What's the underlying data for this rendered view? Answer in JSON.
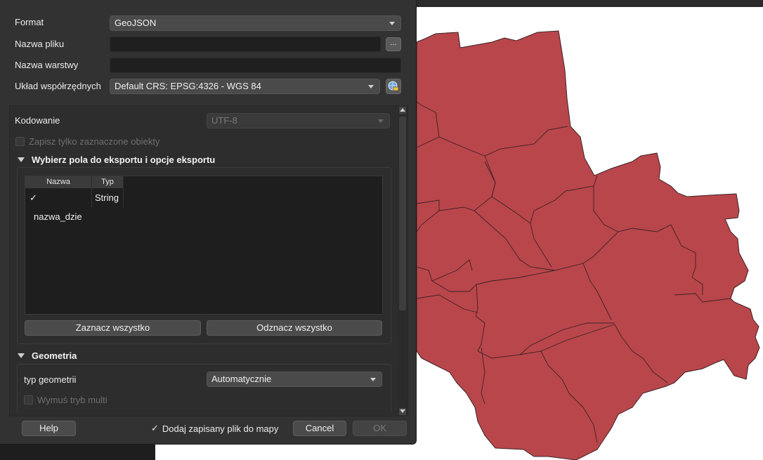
{
  "colors": {
    "district_fill": "#b9464b",
    "district_stroke": "#3b2225",
    "map_bg": "#ffffff"
  },
  "form": {
    "format_label": "Format",
    "format_value": "GeoJSON",
    "filename_label": "Nazwa pliku",
    "filename_value": "",
    "browse_label": "...",
    "layer_label": "Nazwa warstwy",
    "layer_value": "",
    "crs_label": "Układ współrzędnych",
    "crs_value": "Default CRS: EPSG:4326 - WGS 84",
    "crs_button_icon": "crs-selector-icon"
  },
  "options": {
    "encoding_label": "Kodowanie",
    "encoding_value": "UTF-8",
    "selected_only_label": "Zapisz tylko zaznaczone obiekty",
    "fields_section_title": "Wybierz pola do eksportu i opcje eksportu",
    "table": {
      "headers": [
        "Nazwa",
        "Typ"
      ],
      "rows": [
        {
          "checked_mark": "✓",
          "name": "nazwa_dzie",
          "type": "String"
        }
      ]
    },
    "select_all_label": "Zaznacz wszystko",
    "deselect_all_label": "Odznacz wszystko",
    "geometry_section_title": "Geometria",
    "geometry_type_label": "typ geometrii",
    "geometry_type_value": "Automatycznie",
    "force_multi_label": "Wymuś tryb multi"
  },
  "footer": {
    "help_label": "Help",
    "add_to_map_mark": "✓",
    "add_to_map_label": "Dodaj zapisany plik do mapy",
    "cancel_label": "Cancel",
    "ok_label": "OK"
  }
}
